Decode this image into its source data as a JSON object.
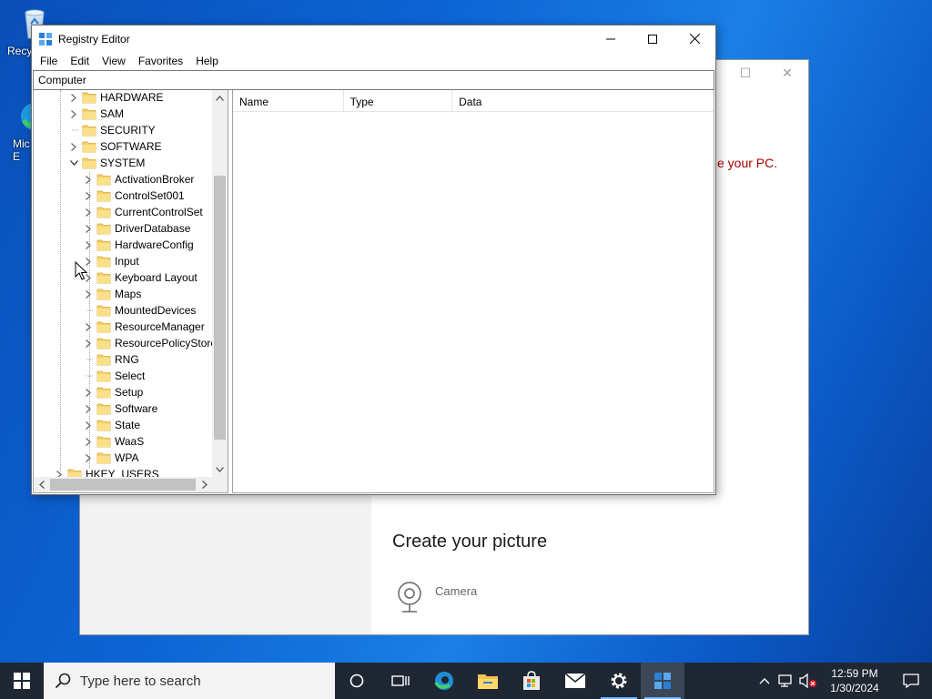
{
  "desktop": {
    "icons": [
      {
        "label": "Recy",
        "icon": "recycle-bin-icon"
      },
      {
        "label": "Mic\nE",
        "icon": "edge-icon"
      }
    ]
  },
  "settings_window": {
    "error_text": "e your PC.",
    "heading": "Create your picture",
    "camera_label": "Camera"
  },
  "regedit": {
    "title": "Registry Editor",
    "menu": [
      "File",
      "Edit",
      "View",
      "Favorites",
      "Help"
    ],
    "address": "Computer",
    "columns": {
      "name": "Name",
      "type": "Type",
      "data": "Data"
    },
    "tree": {
      "level1": [
        {
          "label": "HARDWARE",
          "expander": "collapsed"
        },
        {
          "label": "SAM",
          "expander": "collapsed"
        },
        {
          "label": "SECURITY",
          "expander": "none"
        },
        {
          "label": "SOFTWARE",
          "expander": "collapsed"
        },
        {
          "label": "SYSTEM",
          "expander": "expanded"
        }
      ],
      "system_children": [
        {
          "label": "ActivationBroker",
          "expander": "collapsed"
        },
        {
          "label": "ControlSet001",
          "expander": "collapsed"
        },
        {
          "label": "CurrentControlSet",
          "expander": "collapsed"
        },
        {
          "label": "DriverDatabase",
          "expander": "collapsed"
        },
        {
          "label": "HardwareConfig",
          "expander": "collapsed"
        },
        {
          "label": "Input",
          "expander": "collapsed"
        },
        {
          "label": "Keyboard Layout",
          "expander": "collapsed"
        },
        {
          "label": "Maps",
          "expander": "collapsed"
        },
        {
          "label": "MountedDevices",
          "expander": "none"
        },
        {
          "label": "ResourceManager",
          "expander": "collapsed"
        },
        {
          "label": "ResourcePolicyStore",
          "expander": "collapsed"
        },
        {
          "label": "RNG",
          "expander": "none"
        },
        {
          "label": "Select",
          "expander": "none"
        },
        {
          "label": "Setup",
          "expander": "collapsed"
        },
        {
          "label": "Software",
          "expander": "collapsed"
        },
        {
          "label": "State",
          "expander": "collapsed"
        },
        {
          "label": "WaaS",
          "expander": "collapsed"
        },
        {
          "label": "WPA",
          "expander": "collapsed"
        }
      ],
      "root_next": {
        "label": "HKEY_USERS",
        "expander": "collapsed"
      }
    }
  },
  "taskbar": {
    "search_placeholder": "Type here to search",
    "apps": [
      "task-view-icon",
      "edge-icon",
      "file-explorer-icon",
      "store-icon",
      "mail-icon",
      "settings-icon",
      "registry-editor-icon"
    ],
    "clock_time": "12:59 PM",
    "clock_date": "1/30/2024"
  },
  "colors": {
    "desktop_blue": "#0c64d4",
    "taskbar": "#1f2733",
    "error_red": "#a80000",
    "folder_yellow": "#f5d16c"
  }
}
